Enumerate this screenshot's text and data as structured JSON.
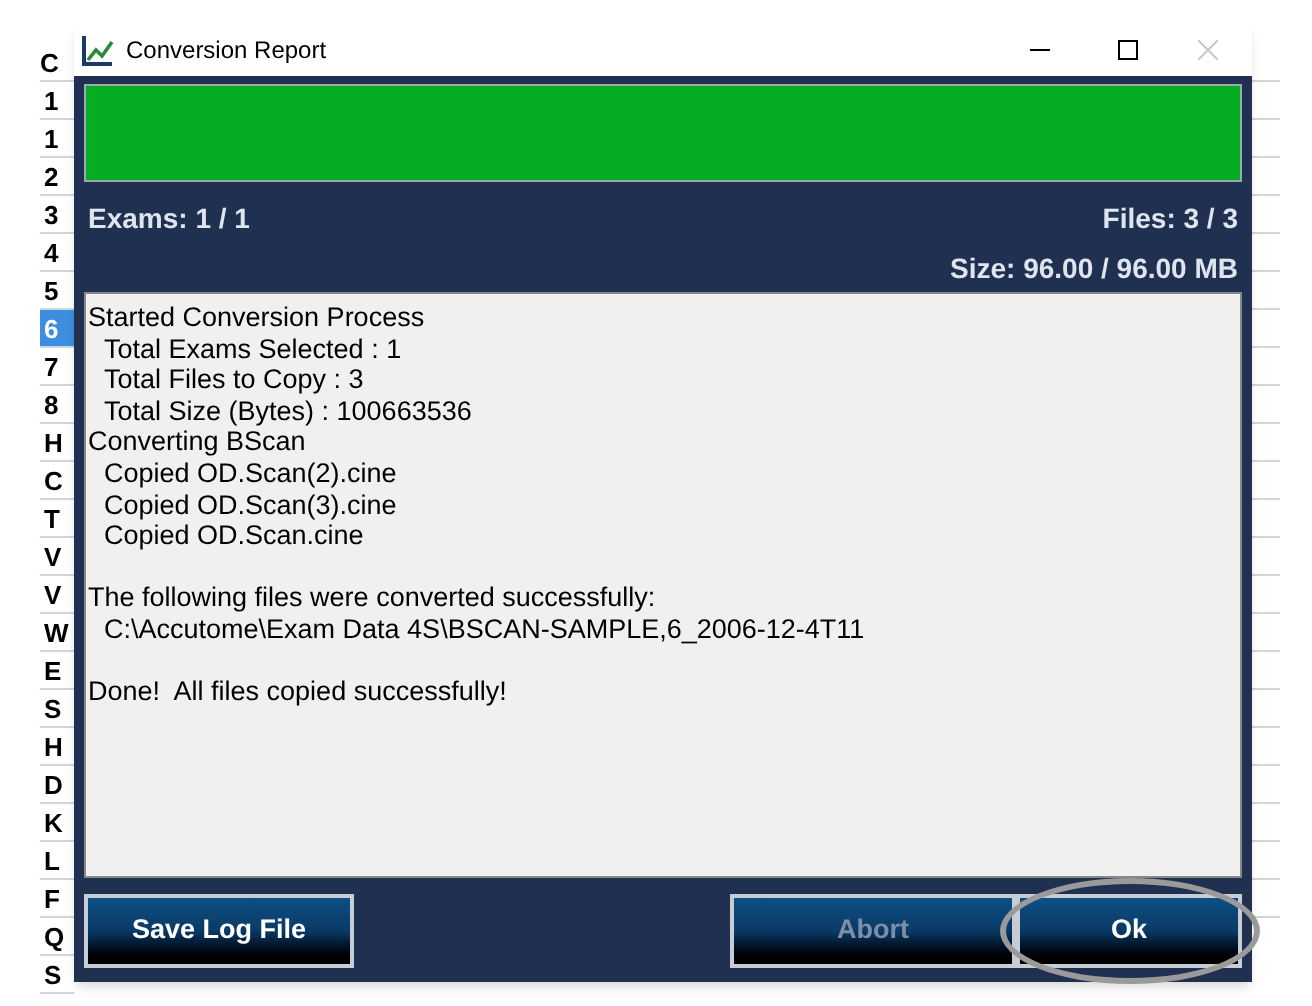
{
  "sheet": {
    "header": "C",
    "rows": [
      {
        "label": "1",
        "selected": false
      },
      {
        "label": "1",
        "selected": false
      },
      {
        "label": "2",
        "selected": false
      },
      {
        "label": "3",
        "selected": false
      },
      {
        "label": "4",
        "selected": false
      },
      {
        "label": "5",
        "selected": false
      },
      {
        "label": "6",
        "selected": true
      },
      {
        "label": "7",
        "selected": false
      },
      {
        "label": "8",
        "selected": false
      },
      {
        "label": "H",
        "selected": false
      },
      {
        "label": "C",
        "selected": false
      },
      {
        "label": "T",
        "selected": false
      },
      {
        "label": "V",
        "selected": false
      },
      {
        "label": "V",
        "selected": false
      },
      {
        "label": "W",
        "selected": false
      },
      {
        "label": "E",
        "selected": false
      },
      {
        "label": "S",
        "selected": false
      },
      {
        "label": "H",
        "selected": false
      },
      {
        "label": "D",
        "selected": false
      },
      {
        "label": "K",
        "selected": false
      },
      {
        "label": "L",
        "selected": false
      },
      {
        "label": "F",
        "selected": false
      },
      {
        "label": "Q",
        "selected": false
      },
      {
        "label": "S",
        "selected": false
      }
    ]
  },
  "window": {
    "title": "Conversion Report",
    "close_disabled": true
  },
  "progress": {
    "level": 1
  },
  "stats": {
    "exams": "Exams: 1 / 1",
    "files": "Files: 3 / 3",
    "size": "Size: 96.00 / 96.00 MB"
  },
  "log": [
    {
      "text": "Started Conversion Process",
      "indented": false,
      "gap_before": false
    },
    {
      "text": "Total Exams Selected : 1",
      "indented": true,
      "gap_before": false
    },
    {
      "text": "Total Files to Copy : 3",
      "indented": true,
      "gap_before": false
    },
    {
      "text": "Total Size (Bytes) : 100663536",
      "indented": true,
      "gap_before": false
    },
    {
      "text": "Converting BScan",
      "indented": false,
      "gap_before": false
    },
    {
      "text": "Copied OD.Scan(2).cine",
      "indented": true,
      "gap_before": false
    },
    {
      "text": "Copied OD.Scan(3).cine",
      "indented": true,
      "gap_before": false
    },
    {
      "text": "Copied OD.Scan.cine",
      "indented": true,
      "gap_before": false
    },
    {
      "text": "The following files were converted successfully:",
      "indented": false,
      "gap_before": true
    },
    {
      "text": "C:\\Accutome\\Exam Data 4S\\BSCAN-SAMPLE,6_2006-12-4T11",
      "indented": true,
      "gap_before": false
    },
    {
      "text": "Done!  All files copied successfully!",
      "indented": false,
      "gap_before": true
    }
  ],
  "buttons": [
    {
      "label": "Save Log File",
      "disabled": false,
      "circled": false
    },
    {
      "label": "Abort",
      "disabled": true,
      "circled": false
    },
    {
      "label": "Ok",
      "disabled": false,
      "circled": true
    }
  ]
}
